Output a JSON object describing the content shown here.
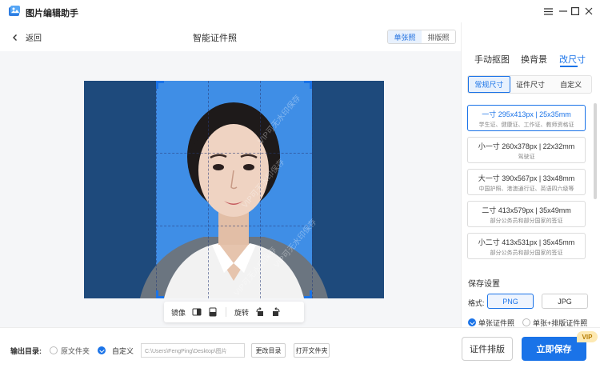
{
  "app": {
    "title": "图片编辑助手"
  },
  "header": {
    "back_label": "返回",
    "page_title": "智能证件照",
    "mode_tabs": [
      {
        "label": "单张照",
        "active": true
      },
      {
        "label": "排版照",
        "active": false
      }
    ]
  },
  "editor": {
    "watermark_text": "VIP可无水印保存",
    "toolbar": {
      "mirror_label": "镜像",
      "rotate_label": "旋转"
    }
  },
  "panel": {
    "tabs": [
      {
        "label": "手动抠图",
        "active": false
      },
      {
        "label": "换背景",
        "active": false
      },
      {
        "label": "改尺寸",
        "active": true
      }
    ],
    "sub_tabs": [
      {
        "label": "常规尺寸",
        "active": true
      },
      {
        "label": "证件尺寸",
        "active": false
      },
      {
        "label": "自定义",
        "active": false
      }
    ],
    "sizes": [
      {
        "title": "一寸 295x413px | 25x35mm",
        "desc": "学生证、健康证、工作证、教师资格证",
        "active": true
      },
      {
        "title": "小一寸 260x378px | 22x32mm",
        "desc": "驾驶证",
        "active": false
      },
      {
        "title": "大一寸 390x567px | 33x48mm",
        "desc": "中国护照、港澳通行证、英语四六级等",
        "active": false
      },
      {
        "title": "二寸 413x579px | 35x49mm",
        "desc": "部分公务员和部分国家的签证",
        "active": false
      },
      {
        "title": "小二寸 413x531px | 35x45mm",
        "desc": "部分公务员和部分国家的签证",
        "active": false
      }
    ],
    "save_settings_title": "保存设置",
    "format_label": "格式:",
    "formats": [
      {
        "label": "PNG",
        "active": true
      },
      {
        "label": "JPG",
        "active": false
      }
    ],
    "output_options": [
      {
        "label": "单张证件照",
        "checked": true
      },
      {
        "label": "单张+排版证件照",
        "checked": false
      }
    ]
  },
  "bottom": {
    "output_dir_label": "输出目录:",
    "source_folder_label": "原文件夹",
    "custom_label": "自定义",
    "path_value": "C:\\Users\\FengPing\\Desktop\\图片",
    "change_dir_label": "更改目录",
    "open_folder_label": "打开文件夹",
    "layout_button": "证件排版",
    "save_button": "立即保存",
    "vip_badge": "VIP"
  },
  "colors": {
    "accent": "#1a73e8",
    "photo_bg_outer": "#1e4a7c",
    "photo_bg_inner": "#3f8ee6"
  }
}
